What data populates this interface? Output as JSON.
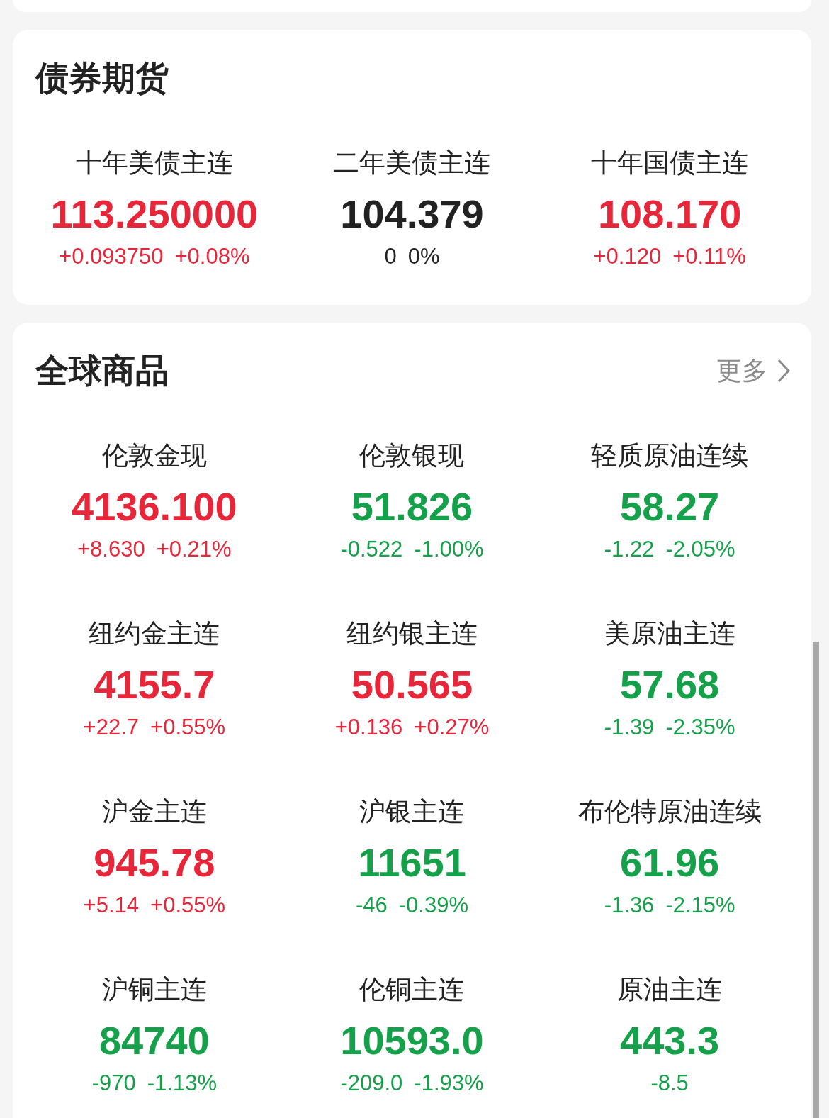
{
  "sections": [
    {
      "title": "债券期货",
      "quotes": [
        {
          "name": "十年美债主连",
          "value": "113.250000",
          "change": "+0.093750",
          "percent": "+0.08%",
          "color": "#e8263a"
        },
        {
          "name": "二年美债主连",
          "value": "104.379",
          "change": "0",
          "percent": "0%",
          "color": "#222222"
        },
        {
          "name": "十年国债主连",
          "value": "108.170",
          "change": "+0.120",
          "percent": "+0.11%",
          "color": "#e8263a"
        }
      ]
    },
    {
      "title": "全球商品",
      "more": "更多",
      "quotes": [
        {
          "name": "伦敦金现",
          "value": "4136.100",
          "change": "+8.630",
          "percent": "+0.21%",
          "color": "#e8263a"
        },
        {
          "name": "伦敦银现",
          "value": "51.826",
          "change": "-0.522",
          "percent": "-1.00%",
          "color": "#15a04a"
        },
        {
          "name": "轻质原油连续",
          "value": "58.27",
          "change": "-1.22",
          "percent": "-2.05%",
          "color": "#15a04a"
        },
        {
          "name": "纽约金主连",
          "value": "4155.7",
          "change": "+22.7",
          "percent": "+0.55%",
          "color": "#e8263a"
        },
        {
          "name": "纽约银主连",
          "value": "50.565",
          "change": "+0.136",
          "percent": "+0.27%",
          "color": "#e8263a"
        },
        {
          "name": "美原油主连",
          "value": "57.68",
          "change": "-1.39",
          "percent": "-2.35%",
          "color": "#15a04a"
        },
        {
          "name": "沪金主连",
          "value": "945.78",
          "change": "+5.14",
          "percent": "+0.55%",
          "color": "#e8263a"
        },
        {
          "name": "沪银主连",
          "value": "11651",
          "change": "-46",
          "percent": "-0.39%",
          "color": "#15a04a"
        },
        {
          "name": "布伦特原油连续",
          "value": "61.96",
          "change": "-1.36",
          "percent": "-2.15%",
          "color": "#15a04a"
        },
        {
          "name": "沪铜主连",
          "value": "84740",
          "change": "-970",
          "percent": "-1.13%",
          "color": "#15a04a"
        },
        {
          "name": "伦铜主连",
          "value": "10593.0",
          "change": "-209.0",
          "percent": "-1.93%",
          "color": "#15a04a"
        },
        {
          "name": "原油主连",
          "value": "443.3",
          "change": "-8.5",
          "color": "#15a04a"
        }
      ]
    }
  ]
}
